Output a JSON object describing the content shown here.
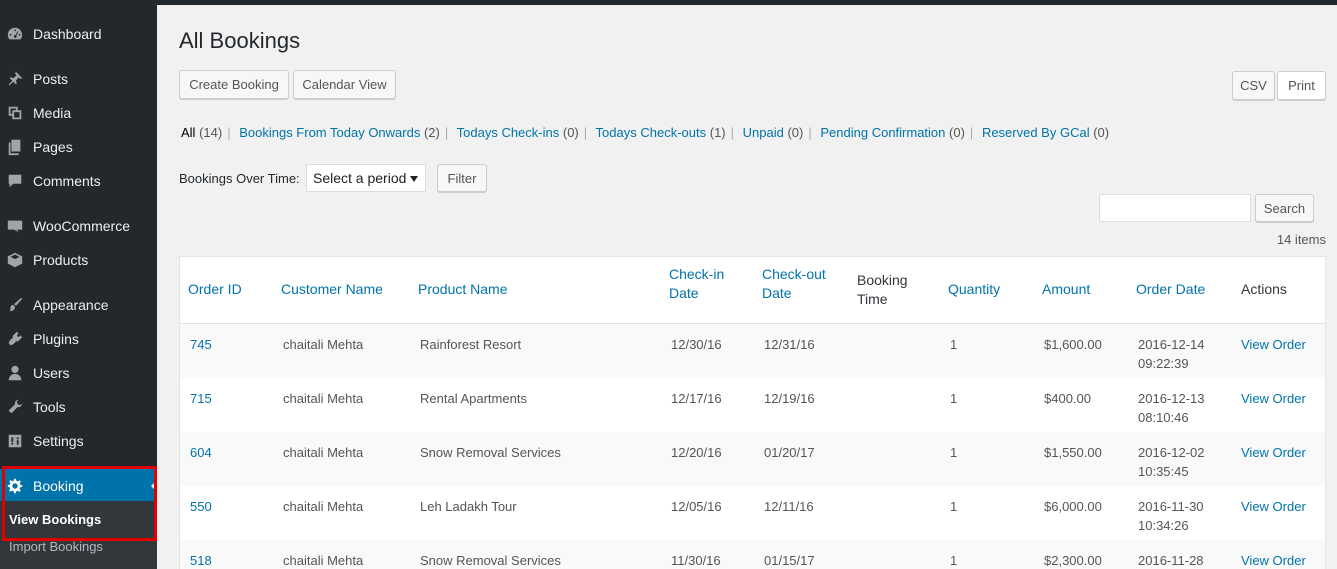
{
  "sidebar": {
    "items": [
      {
        "label": "Dashboard",
        "icon": "dashboard-icon"
      },
      {
        "label": "Posts",
        "icon": "pin-icon"
      },
      {
        "label": "Media",
        "icon": "media-icon"
      },
      {
        "label": "Pages",
        "icon": "pages-icon"
      },
      {
        "label": "Comments",
        "icon": "comments-icon"
      },
      {
        "label": "WooCommerce",
        "icon": "woocommerce-icon"
      },
      {
        "label": "Products",
        "icon": "products-icon"
      },
      {
        "label": "Appearance",
        "icon": "brush-icon"
      },
      {
        "label": "Plugins",
        "icon": "plugins-icon"
      },
      {
        "label": "Users",
        "icon": "users-icon"
      },
      {
        "label": "Tools",
        "icon": "wrench-icon"
      },
      {
        "label": "Settings",
        "icon": "settings-icon"
      },
      {
        "label": "Booking",
        "icon": "gear-icon"
      }
    ],
    "submenu": {
      "current": "View Bookings",
      "other": "Import Bookings"
    },
    "active_color": "#0073aa",
    "highlight_color": "#e00000"
  },
  "main": {
    "title": "All Bookings",
    "buttons": {
      "create": "Create Booking",
      "calendar": "Calendar View",
      "csv": "CSV",
      "print": "Print"
    },
    "views": [
      {
        "label": "All",
        "count": "(14)"
      },
      {
        "label": "Bookings From Today Onwards",
        "count": "(2)"
      },
      {
        "label": "Todays Check-ins",
        "count": "(0)"
      },
      {
        "label": "Todays Check-outs",
        "count": "(1)"
      },
      {
        "label": "Unpaid",
        "count": "(0)"
      },
      {
        "label": "Pending Confirmation",
        "count": "(0)"
      },
      {
        "label": "Reserved By GCal",
        "count": "(0)"
      }
    ],
    "filter": {
      "label": "Bookings Over Time:",
      "select_value": "Select a period",
      "button": "Filter"
    },
    "search": {
      "value": "",
      "button": "Search"
    },
    "items_count": "14 items"
  },
  "table": {
    "columns": [
      {
        "line1": "Order ID",
        "line2": ""
      },
      {
        "line1": "Customer Name",
        "line2": ""
      },
      {
        "line1": "Product Name",
        "line2": ""
      },
      {
        "line1": "Check-in",
        "line2": "Date"
      },
      {
        "line1": "Check-out",
        "line2": "Date"
      },
      {
        "line1": "Booking",
        "line2": "Time"
      },
      {
        "line1": "Quantity",
        "line2": ""
      },
      {
        "line1": "Amount",
        "line2": ""
      },
      {
        "line1": "Order Date",
        "line2": ""
      },
      {
        "line1": "Actions",
        "line2": ""
      }
    ],
    "rows": [
      {
        "id": "745",
        "customer": "chaitali Mehta",
        "product": "Rainforest Resort",
        "checkin": "12/30/16",
        "checkout": "12/31/16",
        "time": "",
        "qty": "1",
        "amount": "$1,600.00",
        "date": "2016-12-14",
        "clock": "09:22:39",
        "action": "View Order"
      },
      {
        "id": "715",
        "customer": "chaitali Mehta",
        "product": "Rental Apartments",
        "checkin": "12/17/16",
        "checkout": "12/19/16",
        "time": "",
        "qty": "1",
        "amount": "$400.00",
        "date": "2016-12-13",
        "clock": "08:10:46",
        "action": "View Order"
      },
      {
        "id": "604",
        "customer": "chaitali Mehta",
        "product": "Snow Removal Services",
        "checkin": "12/20/16",
        "checkout": "01/20/17",
        "time": "",
        "qty": "1",
        "amount": "$1,550.00",
        "date": "2016-12-02",
        "clock": "10:35:45",
        "action": "View Order"
      },
      {
        "id": "550",
        "customer": "chaitali Mehta",
        "product": "Leh Ladakh Tour",
        "checkin": "12/05/16",
        "checkout": "12/11/16",
        "time": "",
        "qty": "1",
        "amount": "$6,000.00",
        "date": "2016-11-30",
        "clock": "10:34:26",
        "action": "View Order"
      },
      {
        "id": "518",
        "customer": "chaitali Mehta",
        "product": "Snow Removal Services",
        "checkin": "11/30/16",
        "checkout": "01/15/17",
        "time": "",
        "qty": "1",
        "amount": "$2,300.00",
        "date": "2016-11-28",
        "clock": "",
        "action": "View Order"
      }
    ]
  }
}
